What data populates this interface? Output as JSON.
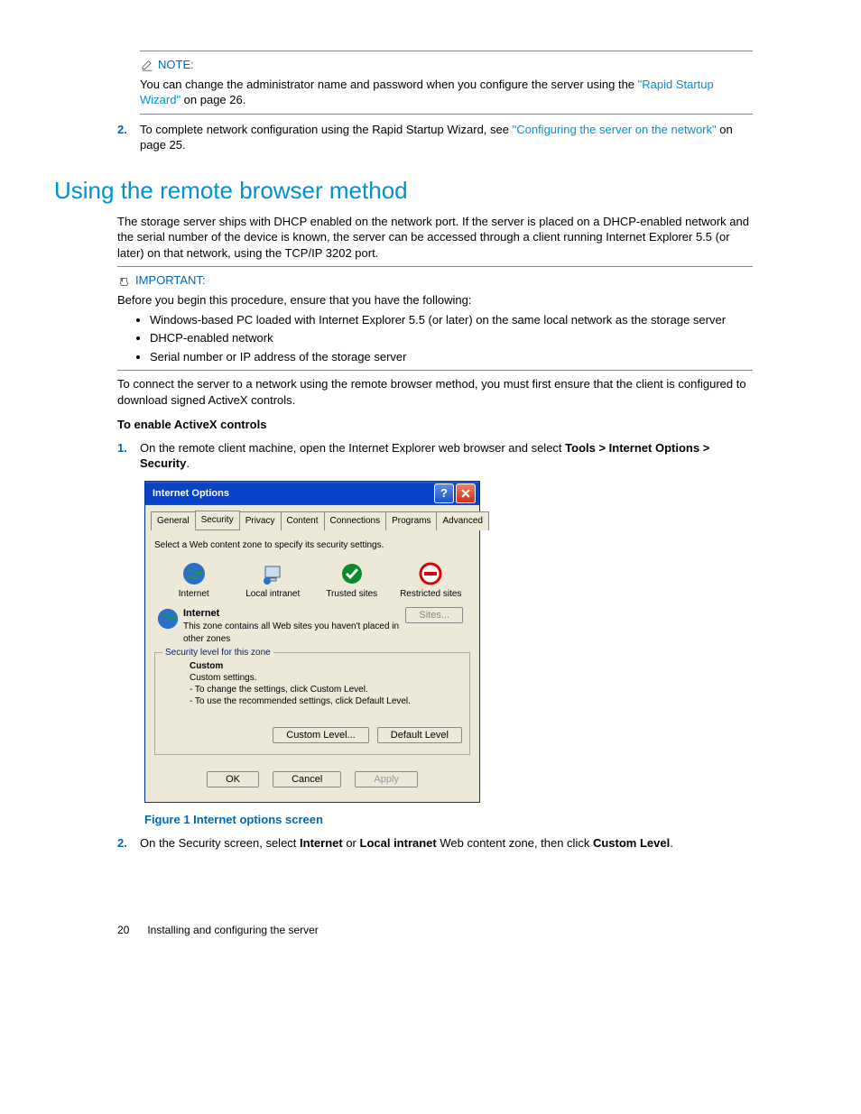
{
  "note": {
    "label": "NOTE:",
    "text_a": "You can change the administrator name and password when you configure the server using the ",
    "link": "\"Rapid Startup Wizard\"",
    "text_b": " on page 26."
  },
  "step2a": {
    "num": "2.",
    "text_a": "To complete network configuration using the Rapid Startup Wizard, see ",
    "link": "\"Configuring the server on the network\"",
    "text_b": " on page 25."
  },
  "section_heading": "Using the remote browser method",
  "intro": "The storage server ships with DHCP enabled on the network port. If the server is placed on a DHCP-enabled network and the serial number of the device is known, the server can be accessed through a client running Internet Explorer 5.5 (or later) on that network, using the TCP/IP 3202 port.",
  "important": {
    "label": "IMPORTANT:",
    "lead": "Before you begin this procedure, ensure that you have the following:",
    "bullets": [
      "Windows-based PC loaded with Internet Explorer 5.5 (or later) on the same local network as the storage server",
      "DHCP-enabled network",
      "Serial number or IP address of the storage server"
    ]
  },
  "connect_para": "To connect the server to a network using the remote browser method, you must first ensure that the client is configured to download signed ActiveX controls.",
  "enable_heading": "To enable ActiveX controls",
  "step1": {
    "num": "1.",
    "text_a": "On the remote client machine, open the Internet Explorer web browser and select ",
    "bold_a": "Tools > Internet Options > Security",
    "tail": "."
  },
  "dialog": {
    "title": "Internet Options",
    "tabs": [
      "General",
      "Security",
      "Privacy",
      "Content",
      "Connections",
      "Programs",
      "Advanced"
    ],
    "active_tab": 1,
    "instruction": "Select a Web content zone to specify its security settings.",
    "zones": [
      "Internet",
      "Local intranet",
      "Trusted sites",
      "Restricted sites"
    ],
    "zone_title": "Internet",
    "zone_desc": "This zone contains all Web sites you haven't placed in other zones",
    "sites_btn": "Sites...",
    "fieldset_legend": "Security level for this zone",
    "custom_title": "Custom",
    "custom_sub": "Custom settings.",
    "custom_l1": "- To change the settings, click Custom Level.",
    "custom_l2": "- To use the recommended settings, click Default Level.",
    "custom_level_btn": "Custom Level...",
    "default_level_btn": "Default Level",
    "ok_btn": "OK",
    "cancel_btn": "Cancel",
    "apply_btn": "Apply"
  },
  "figure_caption": "Figure 1 Internet options screen",
  "step2b": {
    "num": "2.",
    "text_a": "On the Security screen, select ",
    "bold_a": "Internet",
    "mid_a": " or ",
    "bold_b": "Local intranet",
    "mid_b": " Web content zone, then click ",
    "bold_c": "Custom Level",
    "tail": "."
  },
  "footer": {
    "page": "20",
    "text": "Installing and configuring the server"
  }
}
